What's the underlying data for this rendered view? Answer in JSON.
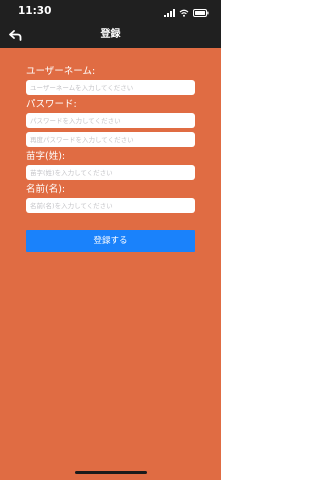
{
  "status_bar": {
    "time": "11:30",
    "icons": [
      "signal-icon",
      "wifi-icon",
      "battery-icon"
    ]
  },
  "nav": {
    "back_icon": "back-arrow-icon",
    "title": "登録"
  },
  "form": {
    "username_label": "ユーザーネーム:",
    "username_placeholder": "ユーザーネームを入力してください",
    "username_value": "",
    "password_label": "パスワード:",
    "password_placeholder": "パスワードを入力してください",
    "password_value": "",
    "password_confirm_placeholder": "再度パスワードを入力してください",
    "password_confirm_value": "",
    "lastname_label": "苗字(姓):",
    "lastname_placeholder": "苗字(姓)を入力してください",
    "lastname_value": "",
    "firstname_label": "名前(名):",
    "firstname_placeholder": "名前(名)を入力してください",
    "firstname_value": ""
  },
  "register_button": {
    "label": "登録する"
  },
  "colors": {
    "background": "#e06c43",
    "bar": "#202020",
    "accent": "#1a82fb",
    "field": "#ffffff",
    "placeholder": "#c4c4c8"
  }
}
